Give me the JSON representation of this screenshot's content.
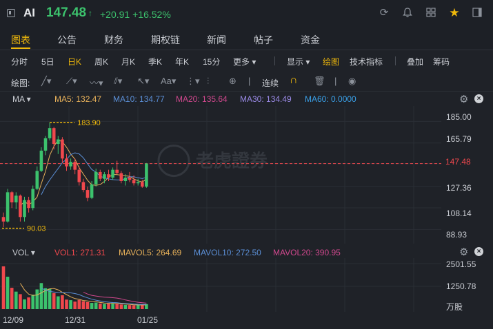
{
  "header": {
    "symbol": "AI",
    "price": "147.48",
    "arrow": "↑",
    "change": "+20.91",
    "change_pct": "+16.52%"
  },
  "tabs": [
    "图表",
    "公告",
    "财务",
    "期权链",
    "新闻",
    "帖子",
    "资金"
  ],
  "periods": [
    "分时",
    "5日",
    "日K",
    "周K",
    "月K",
    "季K",
    "年K",
    "15分",
    "更多 ▾"
  ],
  "period_right": [
    "显示 ▾",
    "绘图",
    "技术指标",
    "叠加",
    "筹码"
  ],
  "tools": {
    "label": "绘图:",
    "continuous": "连续"
  },
  "ma_legend": {
    "title": "MA ▾",
    "items": [
      {
        "label": "MA5: 132.47",
        "color": "#e7b15a"
      },
      {
        "label": "MA10: 134.77",
        "color": "#5b8fd6"
      },
      {
        "label": "MA20: 135.64",
        "color": "#d1488e"
      },
      {
        "label": "MA30: 134.49",
        "color": "#9a8ae6"
      },
      {
        "label": "MA60: 0.0000",
        "color": "#3aa0e8"
      }
    ]
  },
  "price_axis": [
    "185.00",
    "165.79",
    "147.48",
    "127.36",
    "108.14",
    "88.93"
  ],
  "current_price": "147.48",
  "high_marker": "183.90",
  "low_marker": "90.03",
  "vol_legend": {
    "title": "VOL ▾",
    "items": [
      {
        "label": "VOL1: 271.31",
        "color": "#f0484d"
      },
      {
        "label": "MAVOL5: 264.69",
        "color": "#e7b15a"
      },
      {
        "label": "MAVOL10: 272.50",
        "color": "#5b8fd6"
      },
      {
        "label": "MAVOL20: 390.95",
        "color": "#d1488e"
      }
    ]
  },
  "vol_axis": [
    "2501.55",
    "1250.78",
    "万股"
  ],
  "dates": [
    "12/09",
    "12/31",
    "01/25"
  ],
  "watermark": "老虎證券",
  "colors": {
    "up": "#3cc26d",
    "down": "#f0484d",
    "accent": "#f0b90b"
  },
  "chart_data": {
    "type": "candlestick",
    "ylim": [
      88.93,
      185.0
    ],
    "candles": [
      {
        "o": 100,
        "h": 104,
        "l": 91,
        "c": 96,
        "v": 2350
      },
      {
        "o": 96,
        "h": 125,
        "l": 95,
        "c": 122,
        "v": 1780
      },
      {
        "o": 122,
        "h": 123,
        "l": 108,
        "c": 113,
        "v": 1170
      },
      {
        "o": 113,
        "h": 122,
        "l": 107,
        "c": 119,
        "v": 960
      },
      {
        "o": 119,
        "h": 120,
        "l": 96,
        "c": 100,
        "v": 820
      },
      {
        "o": 100,
        "h": 118,
        "l": 96,
        "c": 115,
        "v": 530
      },
      {
        "o": 115,
        "h": 118,
        "l": 104,
        "c": 108,
        "v": 640
      },
      {
        "o": 108,
        "h": 128,
        "l": 106,
        "c": 125,
        "v": 790
      },
      {
        "o": 125,
        "h": 145,
        "l": 124,
        "c": 141,
        "v": 1080
      },
      {
        "o": 141,
        "h": 162,
        "l": 140,
        "c": 159,
        "v": 1430
      },
      {
        "o": 159,
        "h": 172,
        "l": 155,
        "c": 170,
        "v": 1150
      },
      {
        "o": 170,
        "h": 184,
        "l": 168,
        "c": 179,
        "v": 1120
      },
      {
        "o": 179,
        "h": 180,
        "l": 160,
        "c": 165,
        "v": 880
      },
      {
        "o": 165,
        "h": 172,
        "l": 156,
        "c": 169,
        "v": 700
      },
      {
        "o": 169,
        "h": 171,
        "l": 148,
        "c": 152,
        "v": 760
      },
      {
        "o": 152,
        "h": 156,
        "l": 141,
        "c": 145,
        "v": 520
      },
      {
        "o": 145,
        "h": 152,
        "l": 142,
        "c": 149,
        "v": 490
      },
      {
        "o": 149,
        "h": 152,
        "l": 138,
        "c": 142,
        "v": 410
      },
      {
        "o": 142,
        "h": 145,
        "l": 128,
        "c": 131,
        "v": 500
      },
      {
        "o": 131,
        "h": 134,
        "l": 122,
        "c": 124,
        "v": 430
      },
      {
        "o": 124,
        "h": 127,
        "l": 114,
        "c": 117,
        "v": 380
      },
      {
        "o": 117,
        "h": 132,
        "l": 116,
        "c": 129,
        "v": 340
      },
      {
        "o": 129,
        "h": 143,
        "l": 127,
        "c": 140,
        "v": 360
      },
      {
        "o": 140,
        "h": 142,
        "l": 132,
        "c": 134,
        "v": 300
      },
      {
        "o": 134,
        "h": 140,
        "l": 130,
        "c": 138,
        "v": 280
      },
      {
        "o": 138,
        "h": 142,
        "l": 132,
        "c": 135,
        "v": 300
      },
      {
        "o": 135,
        "h": 144,
        "l": 133,
        "c": 142,
        "v": 310
      },
      {
        "o": 142,
        "h": 150,
        "l": 138,
        "c": 139,
        "v": 290
      },
      {
        "o": 139,
        "h": 141,
        "l": 130,
        "c": 132,
        "v": 250
      },
      {
        "o": 132,
        "h": 138,
        "l": 128,
        "c": 135,
        "v": 230
      },
      {
        "o": 135,
        "h": 140,
        "l": 131,
        "c": 133,
        "v": 220
      },
      {
        "o": 133,
        "h": 137,
        "l": 128,
        "c": 130,
        "v": 210
      },
      {
        "o": 130,
        "h": 134,
        "l": 128,
        "c": 131,
        "v": 220
      },
      {
        "o": 131,
        "h": 133,
        "l": 126,
        "c": 127,
        "v": 240
      },
      {
        "o": 127,
        "h": 148,
        "l": 126,
        "c": 147.48,
        "v": 271
      }
    ]
  }
}
